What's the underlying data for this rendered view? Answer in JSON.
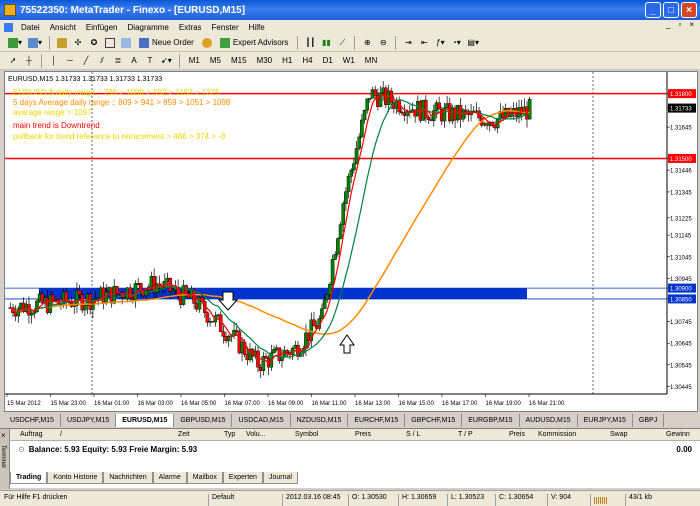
{
  "window": {
    "title": "75522350: MetaTrader - Finexo - [EURUSD,M15]",
    "minimize_label": "_",
    "maximize_label": "□",
    "close_label": "×",
    "mdi_min": "_",
    "mdi_restore": "▫",
    "mdi_close": "×"
  },
  "menu": [
    "Datei",
    "Ansicht",
    "Einfügen",
    "Diagramme",
    "Extras",
    "Fenster",
    "Hilfe"
  ],
  "toolbar1": {
    "new_order": "Neue Order",
    "expert_advisors": "Expert Advisors"
  },
  "toolbar2": {
    "periods": [
      "M1",
      "M5",
      "M15",
      "M30",
      "H1",
      "H4",
      "D1",
      "W1",
      "MN"
    ],
    "text_tool": "A"
  },
  "chart": {
    "header": "EURUSD,M15  1.31733 1.31733 1.31733 1.31733",
    "info_lines": [
      {
        "text": "EURUSD $ daily range :: 796 > 1090 > 592 > 1153 > 1375",
        "color": "#e8d800"
      },
      {
        "text": "5 days Average daily range :: 809 > 941 > 859 > 1051 > 1098",
        "color": "#ff8c00"
      },
      {
        "text": "average range > 1097",
        "color": "#e8d800"
      },
      {
        "text": "main trend is Downtrend",
        "color": "#ff0000"
      },
      {
        "text": "pullback for trend reference to retracement > 486 > 374 > -8",
        "color": "#e8d800"
      }
    ],
    "price_labels": [
      "1.31800",
      "1.31733",
      "1.31645",
      "1.31500",
      "1.31446",
      "1.31345",
      "1.31225",
      "1.31145",
      "1.31045",
      "1.30945",
      "1.30900",
      "1.30850",
      "1.30745",
      "1.30645",
      "1.30545",
      "1.30445"
    ],
    "time_labels": [
      "15 Mar 2012",
      "15 Mar 23:00",
      "16 Mar 01:00",
      "16 Mar 03:00",
      "16 Mar 05:00",
      "16 Mar 07:00",
      "16 Mar 09:00",
      "16 Mar 11:00",
      "16 Mar 13:00",
      "16 Mar 15:00",
      "16 Mar 17:00",
      "16 Mar 19:00",
      "16 Mar 21:00"
    ],
    "levels": {
      "resistance": 1.318,
      "support": 1.315,
      "zone_top": 1.309,
      "zone_bottom": 1.3085
    },
    "colors": {
      "up_candle": "#008000",
      "down_candle": "#ff0000",
      "ma_fast": "#ff0000",
      "ma_mid": "#008040",
      "ma_slow": "#ff8c00",
      "zone": "#0033cc",
      "level_line": "#ff0000"
    }
  },
  "symbol_tabs": [
    "USDCHF,M15",
    "USDJPY,M15",
    "EURUSD,M15",
    "GBPUSD,M15",
    "USDCAD,M15",
    "NZDUSD,M15",
    "EURCHF,M15",
    "GBPCHF,M15",
    "EURGBP,M15",
    "AUDUSD,M15",
    "EURJPY,M15",
    "GBPJ"
  ],
  "terminal": {
    "columns": [
      "Auftrag",
      "/",
      "Zeit",
      "Typ",
      "Volu...",
      "Symbol",
      "Preis",
      "S / L",
      "T / P",
      "Preis",
      "Kommission",
      "Swap",
      "Gewinn"
    ],
    "balance_text": "Balance: 5.93  Equity: 5.93  Freie Margin: 5.93",
    "profit": "0.00",
    "tabs": [
      "Trading",
      "Konto Historie",
      "Nachrichten",
      "Alarme",
      "Mailbox",
      "Experten",
      "Journal"
    ],
    "side_label": "Terminal"
  },
  "status": {
    "help": "Für Hilfe F1 drücken",
    "profile": "Default",
    "datetime": "2012.03.16 08:45",
    "open": "O: 1.30530",
    "high": "H: 1.30659",
    "low": "L: 1.30523",
    "close": "C: 1.30654",
    "volume": "V: 904",
    "traffic": "43/1 kb"
  }
}
